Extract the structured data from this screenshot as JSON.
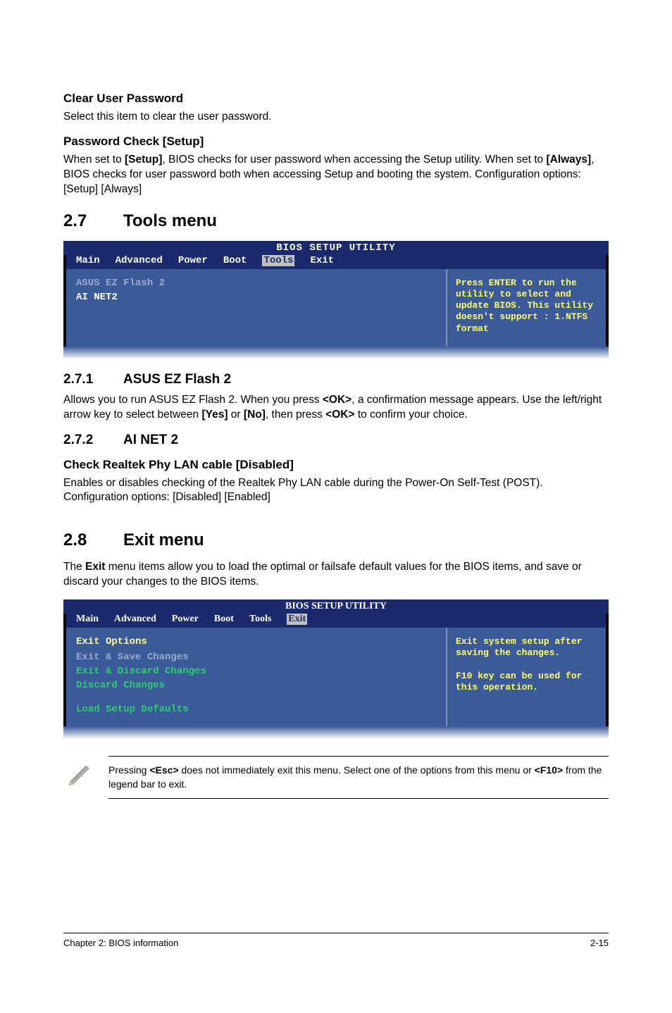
{
  "sections": {
    "clear_user_password": {
      "heading": "Clear User Password",
      "text": "Select this item to clear the user password."
    },
    "password_check": {
      "heading": "Password Check [Setup]",
      "text_parts": [
        "When set to ",
        "[Setup]",
        ", BIOS checks for user password when accessing the Setup utility. When set to ",
        "[Always]",
        ", BIOS checks for user password both when accessing Setup and booting the system. Configuration options: [Setup] [Always]"
      ]
    },
    "tools_menu": {
      "num": "2.7",
      "title": "Tools menu"
    },
    "ez_flash": {
      "num": "2.7.1",
      "title": "ASUS EZ Flash 2",
      "text_parts": [
        "Allows you to run ASUS EZ Flash 2. When you press ",
        "<OK>",
        ", a confirmation message appears. Use the left/right arrow key to select between ",
        "[Yes]",
        " or ",
        "[No]",
        ", then press ",
        "<OK>",
        " to confirm your choice."
      ]
    },
    "ai_net": {
      "num": "2.7.2",
      "title": "AI NET 2"
    },
    "realtek": {
      "heading": "Check Realtek Phy LAN cable [Disabled]",
      "text": "Enables or disables checking of the Realtek Phy LAN cable during the Power-On Self-Test (POST). Configuration options: [Disabled] [Enabled]"
    },
    "exit_menu": {
      "num": "2.8",
      "title": "Exit menu",
      "text_parts": [
        "The ",
        "Exit",
        " menu items allow you to load the optimal or failsafe default values for the BIOS items, and save or discard your changes to the BIOS items."
      ]
    }
  },
  "bios1": {
    "title": "BIOS SETUP UTILITY",
    "tabs": [
      "Main",
      "Advanced",
      "Power",
      "Boot",
      "Tools",
      "Exit"
    ],
    "active_tab": "Tools",
    "left_items": [
      {
        "label": "ASUS EZ Flash 2",
        "style": "faded"
      },
      {
        "label": "AI NET2",
        "style": "item"
      }
    ],
    "right_text": "Press ENTER to run the utility to select and update BIOS. This utility doesn't support : 1.NTFS format"
  },
  "bios2": {
    "title": "BIOS SETUP UTILITY",
    "tabs": [
      "Main",
      "Advanced",
      "Power",
      "Boot",
      "Tools",
      "Exit"
    ],
    "active_tab": "Exit",
    "section_label": "Exit Options",
    "left_items": [
      {
        "label": "Exit & Save Changes",
        "style": "faded"
      },
      {
        "label": "Exit & Discard Changes",
        "style": "green"
      },
      {
        "label": "Discard Changes",
        "style": "green"
      },
      {
        "label": "",
        "style": "blank"
      },
      {
        "label": "Load Setup Defaults",
        "style": "green"
      }
    ],
    "right_text": "Exit system setup after saving the changes.\n\nF10 key can be used for this operation."
  },
  "note": {
    "parts": [
      "Pressing ",
      "<Esc>",
      " does not immediately exit this menu. Select one of the options from this menu or ",
      "<F10>",
      " from the legend bar to exit."
    ]
  },
  "footer": {
    "left": "Chapter 2: BIOS information",
    "right": "2-15"
  }
}
